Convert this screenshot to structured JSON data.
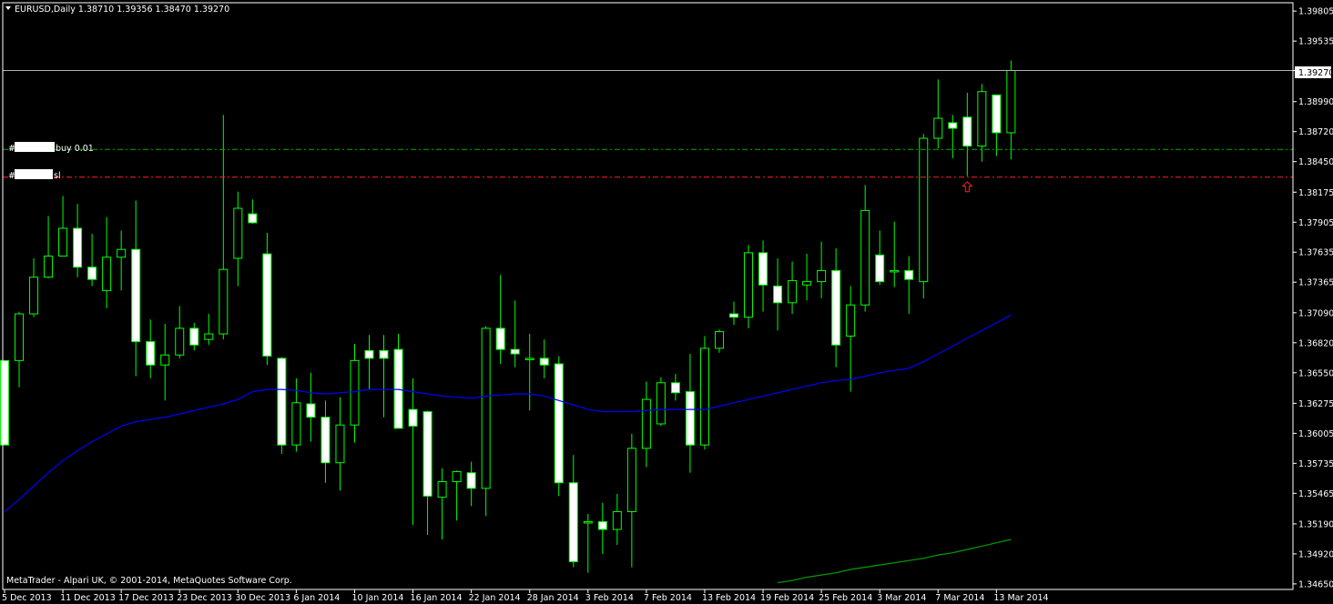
{
  "header": {
    "symbol_info": "EURUSD,Daily  1.38710 1.39356 1.38470 1.39270",
    "dropdown_icon": "triangle-down-icon"
  },
  "footer": {
    "copyright": "MetaTrader - Alpari UK, © 2001-2014, MetaQuotes Software Corp."
  },
  "order_lines": {
    "buy_label": "buy 0.01",
    "buy_prefix": "#",
    "sl_label": "sl",
    "sl_prefix": "#",
    "buy_price": 1.3856,
    "sl_price": 1.3831,
    "buy_color": "#00b000",
    "sl_color": "#ff2020"
  },
  "bid_line": {
    "price": 1.3927,
    "label": "1.39270",
    "color": "#b0b0b0"
  },
  "arrow_marker": {
    "icon": "up-arrow-icon",
    "color": "#ff2020",
    "price": 1.3822
  },
  "colors": {
    "background": "#000000",
    "bull_border": "#00ff00",
    "bear_body": "#ffffff",
    "wick": "#00ff00",
    "ma_fast": "#0000ff",
    "ma_slow": "#00a000",
    "axis": "#ffffff"
  },
  "chart_data": {
    "type": "candlestick",
    "y_ticks": [
      "1.39805",
      "1.39535",
      "1.39270",
      "1.38990",
      "1.38720",
      "1.38450",
      "1.38175",
      "1.37905",
      "1.37635",
      "1.37365",
      "1.37090",
      "1.36820",
      "1.36550",
      "1.36275",
      "1.36005",
      "1.35735",
      "1.35465",
      "1.35190",
      "1.34920",
      "1.34650"
    ],
    "x_ticks": [
      "5 Dec 2013",
      "11 Dec 2013",
      "17 Dec 2013",
      "23 Dec 2013",
      "30 Dec 2013",
      "6 Jan 2014",
      "10 Jan 2014",
      "16 Jan 2014",
      "22 Jan 2014",
      "28 Jan 2014",
      "3 Feb 2014",
      "7 Feb 2014",
      "13 Feb 2014",
      "19 Feb 2014",
      "25 Feb 2014",
      "3 Mar 2014",
      "7 Mar 2014",
      "13 Mar 2014"
    ],
    "x_tick_index": [
      0,
      4,
      8,
      12,
      16,
      20,
      24,
      28,
      32,
      36,
      40,
      44,
      48,
      52,
      56,
      60,
      64,
      68
    ],
    "ylim": [
      1.346,
      1.3988
    ],
    "candles": [
      {
        "o": 1.3666,
        "h": 1.3666,
        "l": 1.361,
        "c": 1.359
      },
      {
        "o": 1.3666,
        "h": 1.371,
        "l": 1.3642,
        "c": 1.3708
      },
      {
        "o": 1.3708,
        "h": 1.3758,
        "l": 1.3705,
        "c": 1.3741
      },
      {
        "o": 1.3741,
        "h": 1.3796,
        "l": 1.374,
        "c": 1.376
      },
      {
        "o": 1.376,
        "h": 1.3814,
        "l": 1.376,
        "c": 1.3785
      },
      {
        "o": 1.3785,
        "h": 1.3807,
        "l": 1.3741,
        "c": 1.375
      },
      {
        "o": 1.375,
        "h": 1.378,
        "l": 1.3733,
        "c": 1.3739
      },
      {
        "o": 1.3729,
        "h": 1.3795,
        "l": 1.3713,
        "c": 1.3759
      },
      {
        "o": 1.3759,
        "h": 1.3783,
        "l": 1.3729,
        "c": 1.3766
      },
      {
        "o": 1.3766,
        "h": 1.381,
        "l": 1.3652,
        "c": 1.3683
      },
      {
        "o": 1.3683,
        "h": 1.3703,
        "l": 1.365,
        "c": 1.3662
      },
      {
        "o": 1.3662,
        "h": 1.3699,
        "l": 1.363,
        "c": 1.3671
      },
      {
        "o": 1.3671,
        "h": 1.3715,
        "l": 1.3668,
        "c": 1.3695
      },
      {
        "o": 1.3695,
        "h": 1.37,
        "l": 1.3675,
        "c": 1.368
      },
      {
        "o": 1.3685,
        "h": 1.3708,
        "l": 1.368,
        "c": 1.369
      },
      {
        "o": 1.369,
        "h": 1.3887,
        "l": 1.3685,
        "c": 1.3748
      },
      {
        "o": 1.3758,
        "h": 1.3818,
        "l": 1.3733,
        "c": 1.3803
      },
      {
        "o": 1.3798,
        "h": 1.3811,
        "l": 1.3789,
        "c": 1.379
      },
      {
        "o": 1.3762,
        "h": 1.3781,
        "l": 1.3662,
        "c": 1.367
      },
      {
        "o": 1.3668,
        "h": 1.3669,
        "l": 1.3582,
        "c": 1.359
      },
      {
        "o": 1.359,
        "h": 1.365,
        "l": 1.3584,
        "c": 1.3628
      },
      {
        "o": 1.3627,
        "h": 1.3655,
        "l": 1.3593,
        "c": 1.3615
      },
      {
        "o": 1.3615,
        "h": 1.363,
        "l": 1.3556,
        "c": 1.3574
      },
      {
        "o": 1.3574,
        "h": 1.3633,
        "l": 1.3549,
        "c": 1.3608
      },
      {
        "o": 1.3608,
        "h": 1.3681,
        "l": 1.3592,
        "c": 1.3666
      },
      {
        "o": 1.3675,
        "h": 1.3689,
        "l": 1.364,
        "c": 1.3668
      },
      {
        "o": 1.3675,
        "h": 1.3689,
        "l": 1.3615,
        "c": 1.3668
      },
      {
        "o": 1.3676,
        "h": 1.369,
        "l": 1.3605,
        "c": 1.3605
      },
      {
        "o": 1.3622,
        "h": 1.365,
        "l": 1.3518,
        "c": 1.3607
      },
      {
        "o": 1.362,
        "h": 1.3621,
        "l": 1.3509,
        "c": 1.3544
      },
      {
        "o": 1.3543,
        "h": 1.3569,
        "l": 1.3505,
        "c": 1.3557
      },
      {
        "o": 1.3557,
        "h": 1.3567,
        "l": 1.3522,
        "c": 1.3566
      },
      {
        "o": 1.3565,
        "h": 1.3575,
        "l": 1.3535,
        "c": 1.3551
      },
      {
        "o": 1.3551,
        "h": 1.3697,
        "l": 1.3526,
        "c": 1.3695
      },
      {
        "o": 1.3695,
        "h": 1.3743,
        "l": 1.3663,
        "c": 1.3676
      },
      {
        "o": 1.3676,
        "h": 1.372,
        "l": 1.366,
        "c": 1.3672
      },
      {
        "o": 1.3668,
        "h": 1.369,
        "l": 1.3621,
        "c": 1.3668
      },
      {
        "o": 1.3668,
        "h": 1.3685,
        "l": 1.365,
        "c": 1.3662
      },
      {
        "o": 1.3663,
        "h": 1.367,
        "l": 1.3544,
        "c": 1.3556
      },
      {
        "o": 1.3556,
        "h": 1.3581,
        "l": 1.348,
        "c": 1.3485
      },
      {
        "o": 1.3521,
        "h": 1.3528,
        "l": 1.3475,
        "c": 1.3521
      },
      {
        "o": 1.3521,
        "h": 1.3538,
        "l": 1.3492,
        "c": 1.3514
      },
      {
        "o": 1.3514,
        "h": 1.3546,
        "l": 1.35,
        "c": 1.353
      },
      {
        "o": 1.353,
        "h": 1.36,
        "l": 1.348,
        "c": 1.3587
      },
      {
        "o": 1.3587,
        "h": 1.3647,
        "l": 1.357,
        "c": 1.3631
      },
      {
        "o": 1.3609,
        "h": 1.3651,
        "l": 1.3607,
        "c": 1.3646
      },
      {
        "o": 1.3646,
        "h": 1.3654,
        "l": 1.363,
        "c": 1.3637
      },
      {
        "o": 1.3638,
        "h": 1.3672,
        "l": 1.3565,
        "c": 1.359
      },
      {
        "o": 1.359,
        "h": 1.3688,
        "l": 1.3586,
        "c": 1.3677
      },
      {
        "o": 1.3677,
        "h": 1.3694,
        "l": 1.3673,
        "c": 1.3692
      },
      {
        "o": 1.3708,
        "h": 1.3719,
        "l": 1.3698,
        "c": 1.3705
      },
      {
        "o": 1.3705,
        "h": 1.377,
        "l": 1.3695,
        "c": 1.3763
      },
      {
        "o": 1.3763,
        "h": 1.3774,
        "l": 1.371,
        "c": 1.3734
      },
      {
        "o": 1.3733,
        "h": 1.3758,
        "l": 1.3693,
        "c": 1.3718
      },
      {
        "o": 1.3718,
        "h": 1.3755,
        "l": 1.3708,
        "c": 1.3738
      },
      {
        "o": 1.3734,
        "h": 1.3762,
        "l": 1.372,
        "c": 1.3737
      },
      {
        "o": 1.3737,
        "h": 1.3773,
        "l": 1.3722,
        "c": 1.3747
      },
      {
        "o": 1.3747,
        "h": 1.3767,
        "l": 1.366,
        "c": 1.368
      },
      {
        "o": 1.3688,
        "h": 1.3733,
        "l": 1.3638,
        "c": 1.3716
      },
      {
        "o": 1.3716,
        "h": 1.3824,
        "l": 1.371,
        "c": 1.3801
      },
      {
        "o": 1.3761,
        "h": 1.3783,
        "l": 1.3734,
        "c": 1.3737
      },
      {
        "o": 1.3747,
        "h": 1.3791,
        "l": 1.3732,
        "c": 1.3747
      },
      {
        "o": 1.3747,
        "h": 1.376,
        "l": 1.3708,
        "c": 1.3739
      },
      {
        "o": 1.3737,
        "h": 1.387,
        "l": 1.3722,
        "c": 1.3866
      },
      {
        "o": 1.3866,
        "h": 1.3919,
        "l": 1.3857,
        "c": 1.3884
      },
      {
        "o": 1.388,
        "h": 1.3887,
        "l": 1.3848,
        "c": 1.3875
      },
      {
        "o": 1.3885,
        "h": 1.3907,
        "l": 1.3832,
        "c": 1.3859
      },
      {
        "o": 1.3859,
        "h": 1.3915,
        "l": 1.3845,
        "c": 1.3908
      },
      {
        "o": 1.3905,
        "h": 1.3902,
        "l": 1.385,
        "c": 1.3871
      },
      {
        "o": 1.3871,
        "h": 1.3936,
        "l": 1.3847,
        "c": 1.3927
      }
    ],
    "ma_fast": [
      1.353,
      1.3541,
      1.3553,
      1.3565,
      1.3576,
      1.3585,
      1.3593,
      1.36,
      1.3607,
      1.3611,
      1.3613,
      1.3615,
      1.3618,
      1.3621,
      1.3624,
      1.3627,
      1.3631,
      1.3638,
      1.364,
      1.364,
      1.3639,
      1.3637,
      1.3636,
      1.3637,
      1.3638,
      1.364,
      1.364,
      1.364,
      1.3638,
      1.3636,
      1.3634,
      1.3633,
      1.3632,
      1.3634,
      1.3635,
      1.3636,
      1.3636,
      1.3634,
      1.363,
      1.3626,
      1.3622,
      1.362,
      1.362,
      1.362,
      1.3621,
      1.3622,
      1.3622,
      1.3622,
      1.3622,
      1.3625,
      1.3628,
      1.3631,
      1.3634,
      1.3637,
      1.364,
      1.3643,
      1.3646,
      1.3648,
      1.3649,
      1.3652,
      1.3655,
      1.3657,
      1.3659,
      1.3665,
      1.3672,
      1.3679,
      1.3686,
      1.3693,
      1.37,
      1.3707
    ],
    "ma_slow": [
      1.3466,
      1.3468,
      1.3471,
      1.3473,
      1.3475,
      1.3478,
      1.348,
      1.3482,
      1.3484,
      1.3486,
      1.3488,
      1.3491,
      1.3493,
      1.3496,
      1.3499,
      1.3502,
      1.3505
    ]
  }
}
